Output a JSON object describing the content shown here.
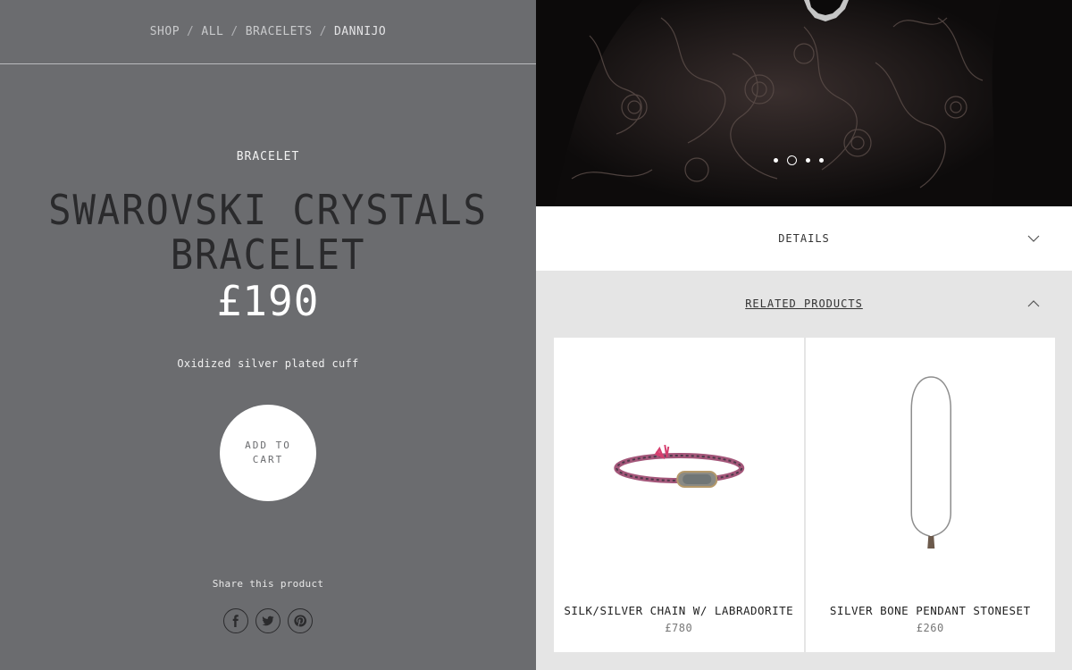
{
  "breadcrumb": [
    {
      "label": "SHOP"
    },
    {
      "label": "ALL"
    },
    {
      "label": "BRACELETS"
    },
    {
      "label": "DANNIJO"
    }
  ],
  "breadcrumb_separator": "/",
  "product": {
    "category": "BRACELET",
    "title": "SWAROVSKI CRYSTALS BRACELET",
    "price": "£190",
    "description": "Oxidized silver plated cuff",
    "add_to_cart": "ADD TO CART"
  },
  "share": {
    "label": "Share this product",
    "icons": [
      "facebook-icon",
      "twitter-icon",
      "pinterest-icon"
    ]
  },
  "gallery": {
    "slide_count": 4,
    "active_index": 1
  },
  "accordion": {
    "details_label": "DETAILS",
    "related_label": "RELATED PRODUCTS"
  },
  "related": [
    {
      "name": "SILK/SILVER CHAIN W/ LABRADORITE",
      "price": "£780"
    },
    {
      "name": "SILVER BONE PENDANT STONESET",
      "price": "£260"
    }
  ],
  "colors": {
    "left_bg": "#6b6c6f",
    "right_bg": "#e5e5e5",
    "title": "#2a2a2c",
    "price": "#ffffff"
  }
}
